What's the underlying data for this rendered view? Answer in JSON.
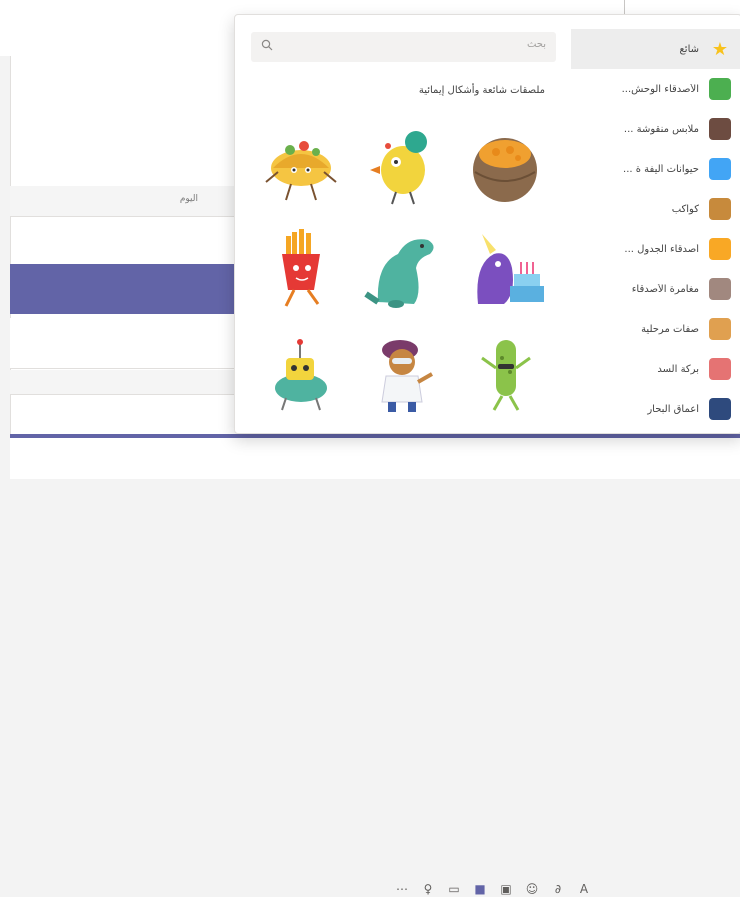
{
  "background": {
    "top_label": "",
    "day_label": "اليوم"
  },
  "composer": {
    "tools": [
      {
        "icon": "more-options-icon",
        "glyph": "⋯"
      },
      {
        "icon": "praise-icon",
        "glyph": "♀"
      },
      {
        "icon": "meet-now-icon",
        "glyph": "▭"
      },
      {
        "icon": "sticker-icon",
        "glyph": "■"
      },
      {
        "icon": "gif-icon",
        "glyph": "▣"
      },
      {
        "icon": "emoji-icon",
        "glyph": "☺"
      },
      {
        "icon": "attach-icon",
        "glyph": "∂"
      },
      {
        "icon": "format-icon",
        "glyph": "A"
      }
    ]
  },
  "stickers": {
    "search_placeholder": "بحث",
    "section_title": "ملصقات شائعة وأشكال إيمائية",
    "categories": [
      {
        "label": "شائع",
        "icon": "star-icon",
        "color": "#f8c21c",
        "selected": true
      },
      {
        "label": "الأصدقاء الوحش...",
        "icon": "monster-friends-icon",
        "color": "#4caf50"
      },
      {
        "label": "ملابس منقوشة ...",
        "icon": "plaid-clothes-icon",
        "color": "#6d4c41"
      },
      {
        "label": "حيوانات أليفة ة ...",
        "icon": "pets-icon",
        "color": "#42a5f5"
      },
      {
        "label": "كواكب",
        "icon": "planets-icon",
        "color": "#c78a3c"
      },
      {
        "label": "أصدقاء الجدول ...",
        "icon": "schedule-friends-icon",
        "color": "#f9a825"
      },
      {
        "label": "مغامرة الأصدقاء",
        "icon": "friends-adventure-icon",
        "color": "#a1887f"
      },
      {
        "label": "صفات مرحلية",
        "icon": "traits-icon",
        "color": "#e0a050"
      },
      {
        "label": "بركة السد",
        "icon": "pond-icon",
        "color": "#e57373"
      },
      {
        "label": "أعماق البحار",
        "icon": "deep-sea-icon",
        "color": "#2e4a7d"
      }
    ],
    "items": [
      {
        "name": "sticker-taco"
      },
      {
        "name": "sticker-yellow-bird"
      },
      {
        "name": "sticker-pumpkin-pie"
      },
      {
        "name": "sticker-french-fries"
      },
      {
        "name": "sticker-dinosaur"
      },
      {
        "name": "sticker-unicorn-cake"
      },
      {
        "name": "sticker-robot-turtle"
      },
      {
        "name": "sticker-scientist"
      },
      {
        "name": "sticker-pickle"
      }
    ]
  }
}
